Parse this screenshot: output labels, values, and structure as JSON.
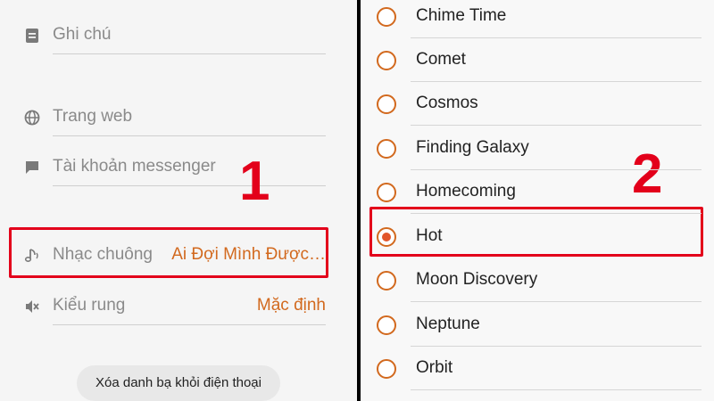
{
  "contact_fields": {
    "note": {
      "label": "Ghi chú",
      "icon": "note-icon"
    },
    "website": {
      "label": "Trang web",
      "icon": "globe-icon"
    },
    "messenger": {
      "label": "Tài khoản messenger",
      "icon": "chat-bubble-icon"
    },
    "ringtone": {
      "label": "Nhạc chuông",
      "value": "Ai Đợi Mình Được…",
      "icon": "music-note-icon"
    },
    "vibration": {
      "label": "Kiểu rung",
      "value": "Mặc định",
      "icon": "vibration-off-icon"
    }
  },
  "delete_button": "Xóa danh bạ khỏi điện thoại",
  "annotations": {
    "step1": "1",
    "step2": "2",
    "color": "#e3001b"
  },
  "ringtone_options": [
    {
      "name": "Chime Time",
      "selected": false
    },
    {
      "name": "Comet",
      "selected": false
    },
    {
      "name": "Cosmos",
      "selected": false
    },
    {
      "name": "Finding Galaxy",
      "selected": false
    },
    {
      "name": "Homecoming",
      "selected": false
    },
    {
      "name": "Hot",
      "selected": true
    },
    {
      "name": "Moon Discovery",
      "selected": false
    },
    {
      "name": "Neptune",
      "selected": false
    },
    {
      "name": "Orbit",
      "selected": false
    }
  ],
  "colors": {
    "accent": "#d2691e",
    "radio_selected": "#e2562b"
  }
}
